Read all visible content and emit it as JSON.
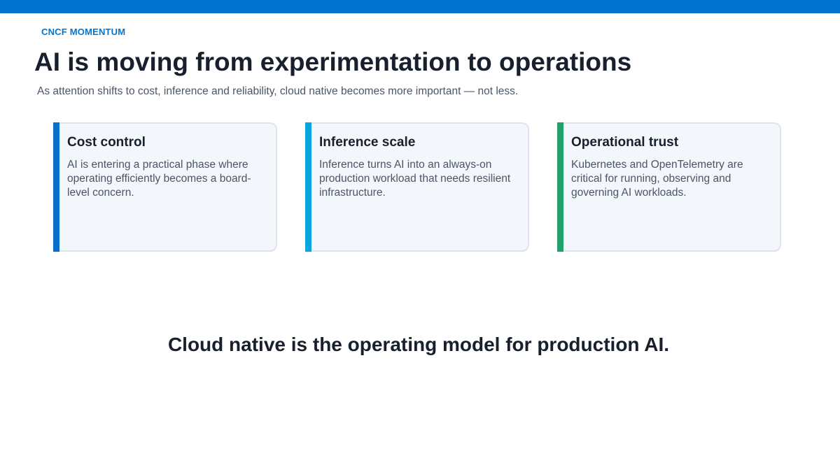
{
  "header": {
    "eyebrow": "CNCF MOMENTUM",
    "title": "AI is moving from experimentation to operations",
    "subtitle": "As attention shifts to cost, inference and reliability, cloud native becomes more important — not less."
  },
  "cards": [
    {
      "title": "Cost control",
      "body": "AI is entering a practical phase where operating efficiently becomes a board-level concern.",
      "accent_color": "#0A6FC9"
    },
    {
      "title": "Inference scale",
      "body": "Inference turns AI into an always-on production workload that needs resilient infrastructure.",
      "accent_color": "#09A5DC"
    },
    {
      "title": "Operational trust",
      "body": "Kubernetes and OpenTelemetry are critical for running, observing and governing AI workloads.",
      "accent_color": "#22A06B"
    }
  ],
  "takeaway": "Cloud native is the operating model for production AI.",
  "colors": {
    "brand_bar": "#0073CF",
    "eyebrow": "#0A74CC",
    "heading": "#18202E",
    "body_text": "#4A5568",
    "card_background": "#F3F6FA",
    "card_border": "#DDE4EC"
  }
}
